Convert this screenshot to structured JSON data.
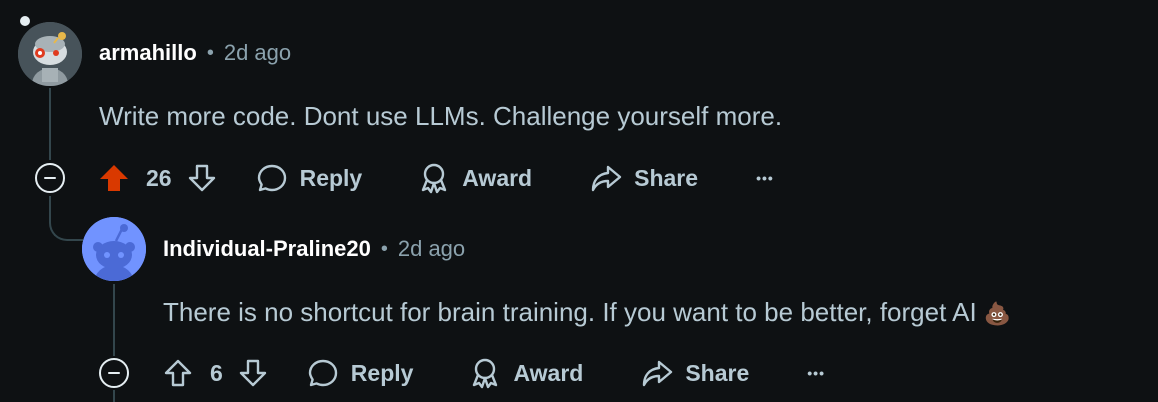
{
  "comments": [
    {
      "username": "armahillo",
      "separator": "•",
      "time": "2d ago",
      "body": "Write more code. Dont use LLMs. Challenge yourself more.",
      "votes": "26",
      "upvoted": true,
      "actions": {
        "reply": "Reply",
        "award": "Award",
        "share": "Share",
        "more": "•••"
      }
    },
    {
      "username": "Individual-Praline20",
      "separator": "•",
      "time": "2d ago",
      "body": "There is no shortcut for brain training. If you want to be better, forget AI",
      "emoji": "💩",
      "votes": "6",
      "upvoted": false,
      "actions": {
        "reply": "Reply",
        "award": "Award",
        "share": "Share",
        "more": "•••"
      }
    }
  ],
  "colors": {
    "background": "#0e1113",
    "username": "#ffffff",
    "meta": "#8ba2ad",
    "text": "#b7cad4",
    "upvote_active": "#d93900",
    "thread_line": "#33464c",
    "reply_avatar_bg": "#7193ff"
  },
  "icons": {
    "upvote": "arrow-up-icon",
    "downvote": "arrow-down-icon",
    "reply": "speech-bubble-icon",
    "award": "award-ribbon-icon",
    "share": "share-arrow-icon",
    "collapse": "minus-circle-icon"
  }
}
